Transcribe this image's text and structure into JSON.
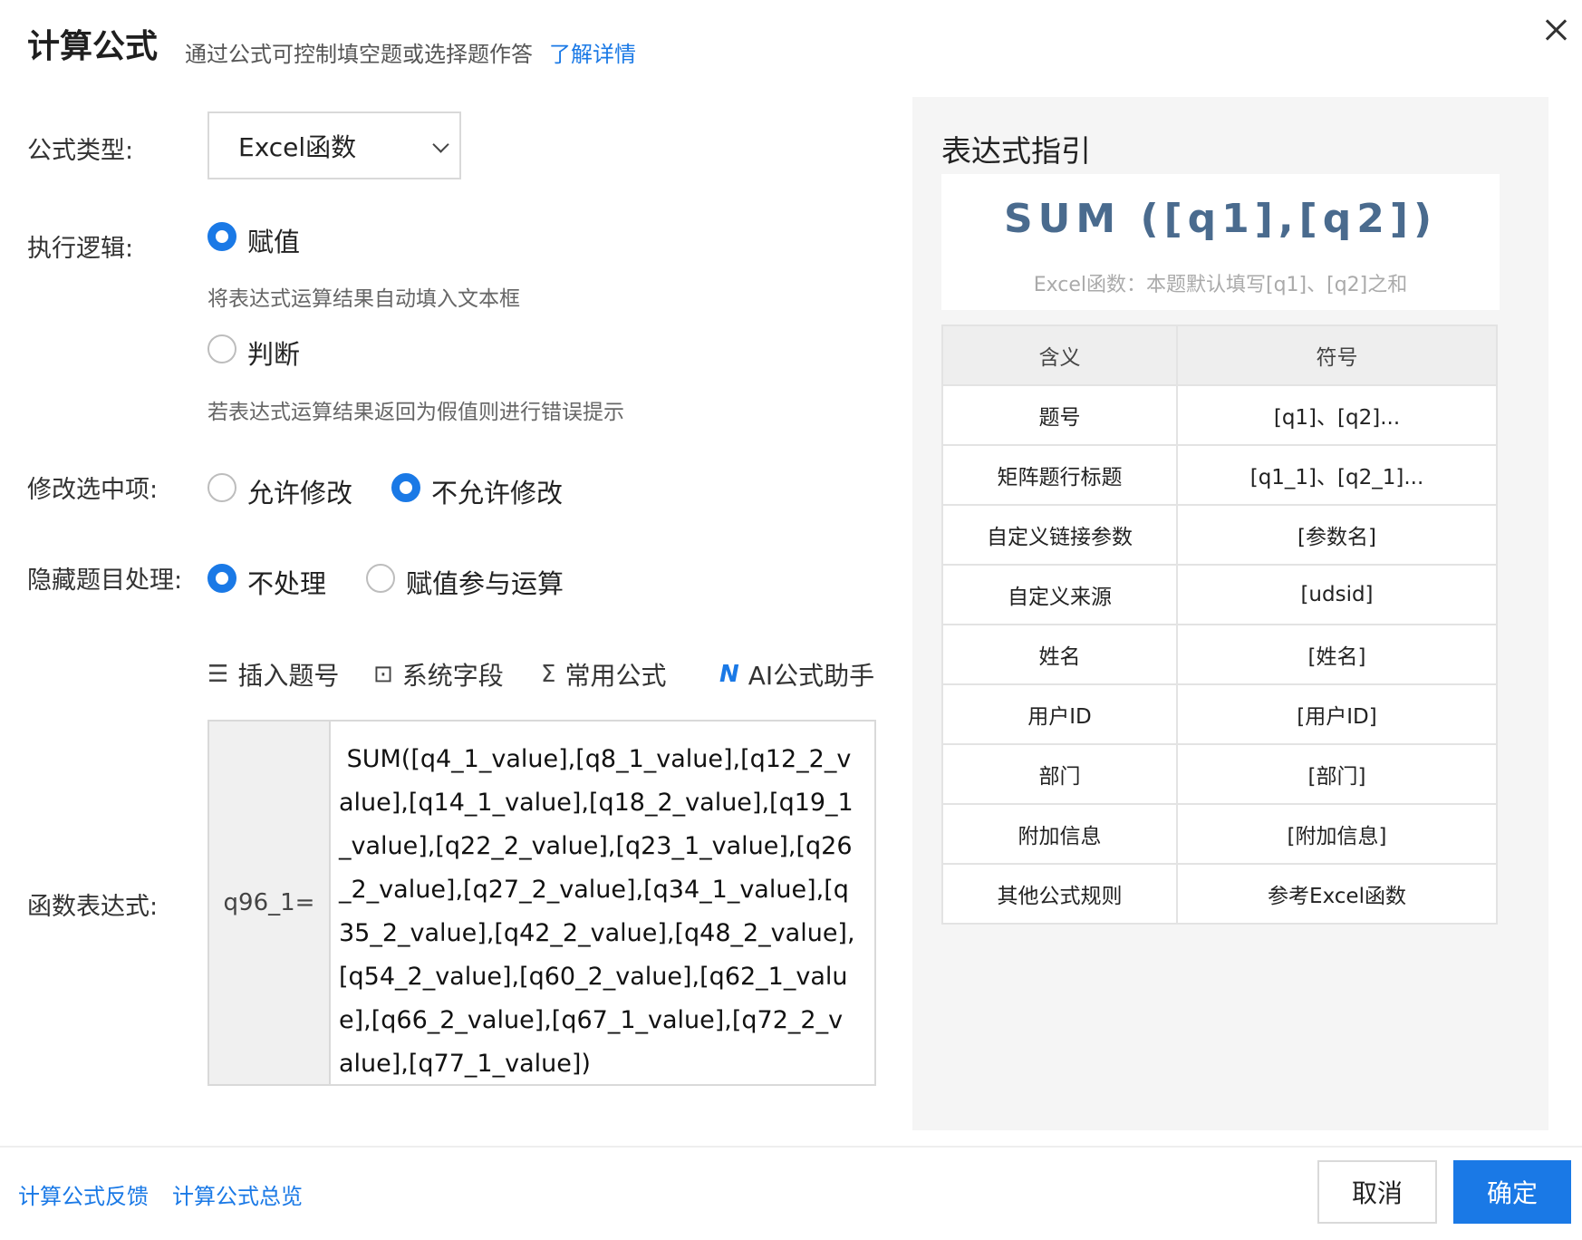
{
  "header": {
    "title": "计算公式",
    "subtitle": "通过公式可控制填空题或选择题作答",
    "learn_more": "了解详情"
  },
  "form": {
    "formula_type": {
      "label": "公式类型:",
      "value": "Excel函数"
    },
    "logic": {
      "label": "执行逻辑:",
      "options": [
        {
          "label": "赋值",
          "checked": true,
          "hint": "将表达式运算结果自动填入文本框"
        },
        {
          "label": "判断",
          "checked": false,
          "hint": "若表达式运算结果返回为假值则进行错误提示"
        }
      ]
    },
    "modify": {
      "label": "修改选中项:",
      "options": [
        {
          "label": "允许修改",
          "checked": false
        },
        {
          "label": "不允许修改",
          "checked": true
        }
      ]
    },
    "hidden": {
      "label": "隐藏题目处理:",
      "options": [
        {
          "label": "不处理",
          "checked": true
        },
        {
          "label": "赋值参与运算",
          "checked": false
        }
      ]
    },
    "toolbar": [
      {
        "icon": "list-numbered-icon",
        "label": "插入题号"
      },
      {
        "icon": "field-box-icon",
        "label": "系统字段"
      },
      {
        "icon": "sigma-icon",
        "label": "常用公式"
      },
      {
        "icon": "ai-logo-icon",
        "label": "AI公式助手"
      }
    ],
    "expression": {
      "label": "函数表达式:",
      "prefix": "q96_1=",
      "value": " SUM([q4_1_value],[q8_1_value],[q12_2_value],[q14_1_value],[q18_2_value],[q19_1_value],[q22_2_value],[q23_1_value],[q26_2_value],[q27_2_value],[q34_1_value],[q35_2_value],[q42_2_value],[q48_2_value],[q54_2_value],[q60_2_value],[q62_1_value],[q66_2_value],[q67_1_value],[q72_2_value],[q77_1_value])"
    }
  },
  "guide": {
    "title": "表达式指引",
    "example": "SUM ([q1],[q2])",
    "example_desc": "Excel函数：本题默认填写[q1]、[q2]之和",
    "headers": [
      "含义",
      "符号"
    ],
    "rows": [
      [
        "题号",
        "[q1]、[q2]..."
      ],
      [
        "矩阵题行标题",
        "[q1_1]、[q2_1]..."
      ],
      [
        "自定义链接参数",
        "[参数名]"
      ],
      [
        "自定义来源",
        "[udsid]"
      ],
      [
        "姓名",
        "[姓名]"
      ],
      [
        "用户ID",
        "[用户ID]"
      ],
      [
        "部门",
        "[部门]"
      ],
      [
        "附加信息",
        "[附加信息]"
      ],
      [
        "其他公式规则",
        "参考Excel函数"
      ]
    ]
  },
  "footer": {
    "feedback": "计算公式反馈",
    "overview": "计算公式总览",
    "cancel": "取消",
    "confirm": "确定"
  },
  "colors": {
    "accent": "#1a79e6",
    "guide_bg": "#f5f5f5",
    "formula": "#4a6b8e"
  }
}
